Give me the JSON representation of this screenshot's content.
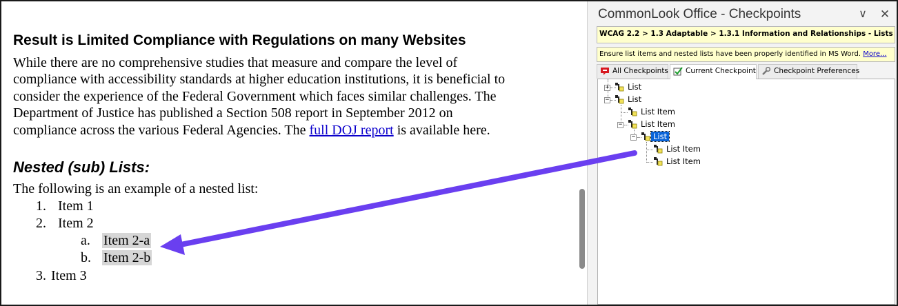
{
  "document": {
    "heading": "Result is Limited Compliance with Regulations on many Websites",
    "paragraph": {
      "line1": "While there are no comprehensive studies that measure and compare the level of",
      "line2": "compliance with accessibility standards at higher education institutions, it is beneficial to",
      "line3": "consider the experience of the Federal Government which faces similar challenges. The",
      "line4": "Department of Justice has published a Section 508 report in September 2012 on",
      "line5_before": "compliance across the various Federal Agencies.  The ",
      "line5_link": "full DOJ report",
      "line5_after": " is available here."
    },
    "subheading": "Nested (sub) Lists:",
    "intro": "The following is an example of a nested list:",
    "list": [
      {
        "marker": "1.",
        "text": "Item 1"
      },
      {
        "marker": "2.",
        "text": "Item 2"
      },
      {
        "marker": "a.",
        "text": "Item 2-a"
      },
      {
        "marker": "b.",
        "text": "Item 2-b"
      },
      {
        "marker": "3.",
        "text": "Item 3"
      }
    ]
  },
  "panel": {
    "title": "CommonLook Office - Checkpoints",
    "menu_glyph": "∨",
    "close_glyph": "✕",
    "breadcrumb": "WCAG 2.2 > 1.3 Adaptable > 1.3.1 Information and Relationships - Lists",
    "hint_text": "Ensure list items and nested lists have been properly identified in MS Word. ",
    "hint_more": "More...",
    "tabs": {
      "all": "All Checkpoints",
      "current": "Current Checkpoint",
      "prefs": "Checkpoint Preferences"
    },
    "tree": {
      "n1": "List",
      "n2": "List",
      "n3": "List Item",
      "n4": "List Item",
      "n5": "List",
      "n6": "List Item",
      "n7": "List Item"
    },
    "expanders": {
      "n1": "+",
      "n2": "−",
      "n4": "−",
      "n5": "−"
    }
  },
  "colors": {
    "arrow": "#6a3ff0",
    "link": "#0b00cc",
    "selection": "#0a64d8",
    "highlight": "#d6d6d6",
    "note_bg": "#ffffcc"
  }
}
